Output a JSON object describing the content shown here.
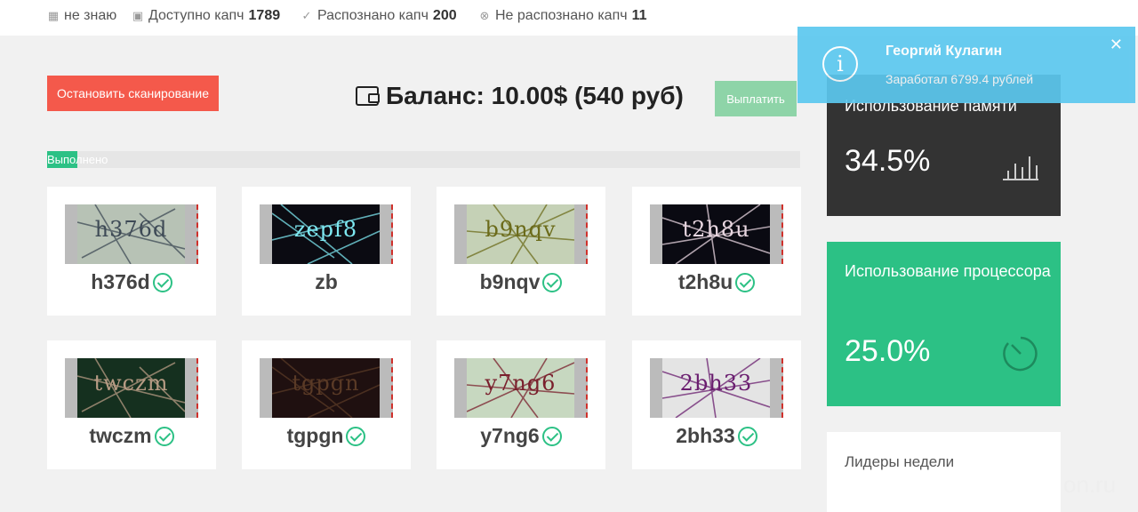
{
  "topbar": {
    "unknown_label": "не знаю",
    "available_label": "Доступно капч",
    "available_count": "1789",
    "recognized_label": "Распознано капч",
    "recognized_count": "200",
    "unrecognized_label": "Не распознано капч",
    "unrecognized_count": "11"
  },
  "controls": {
    "stop_label": "Остановить сканирование",
    "balance_text": "Баланс: 10.00$ (540 руб)",
    "payout_label": "Выплатить"
  },
  "progress": {
    "label": "Выполнено",
    "fraction": 0.04
  },
  "captchas": [
    {
      "answer": "h376d",
      "image_text": "h376d",
      "bg": "#b7c2b5",
      "fg": "#3e4a56",
      "recognized": true
    },
    {
      "answer": "zb",
      "image_text": "zepf8",
      "bg": "#0b0b12",
      "fg": "#7de7f0",
      "recognized": false
    },
    {
      "answer": "b9nqv",
      "image_text": "b9nqv",
      "bg": "#c5d1b6",
      "fg": "#6b6b1a",
      "recognized": true
    },
    {
      "answer": "t2h8u",
      "image_text": "t2h8u",
      "bg": "#0a0a12",
      "fg": "#e8d6e0",
      "recognized": true
    },
    {
      "answer": "twczm",
      "image_text": "twczm",
      "bg": "#15301f",
      "fg": "#b79b84",
      "recognized": true
    },
    {
      "answer": "tgpgn",
      "image_text": "tgpgn",
      "bg": "#1f1010",
      "fg": "#5a3a26",
      "recognized": true
    },
    {
      "answer": "y7ng6",
      "image_text": "y7ng6",
      "bg": "#c7d8c0",
      "fg": "#7a1f2c",
      "recognized": true
    },
    {
      "answer": "2bh33",
      "image_text": "2bh33",
      "bg": "#e4e4e4",
      "fg": "#6a1d6f",
      "recognized": true
    }
  ],
  "panels": {
    "memory_title": "Использование памяти",
    "memory_value": "34.5%",
    "cpu_title": "Использование процессора",
    "cpu_value": "25.0%",
    "leaders_title": "Лидеры недели"
  },
  "toast": {
    "name": "Георгий Кулагин",
    "message": "Заработал 6799.4 рублей"
  },
  "watermark": "on.ru",
  "colors": {
    "green": "#2cc185",
    "red": "#f4594b",
    "dark": "#333333",
    "toast": "#5cc8ef"
  },
  "icons": [
    "calendar-icon",
    "image-icon",
    "check-circle-icon",
    "x-circle-icon",
    "wallet-icon",
    "bar-chart-icon",
    "timer-icon",
    "info-icon",
    "close-icon"
  ]
}
